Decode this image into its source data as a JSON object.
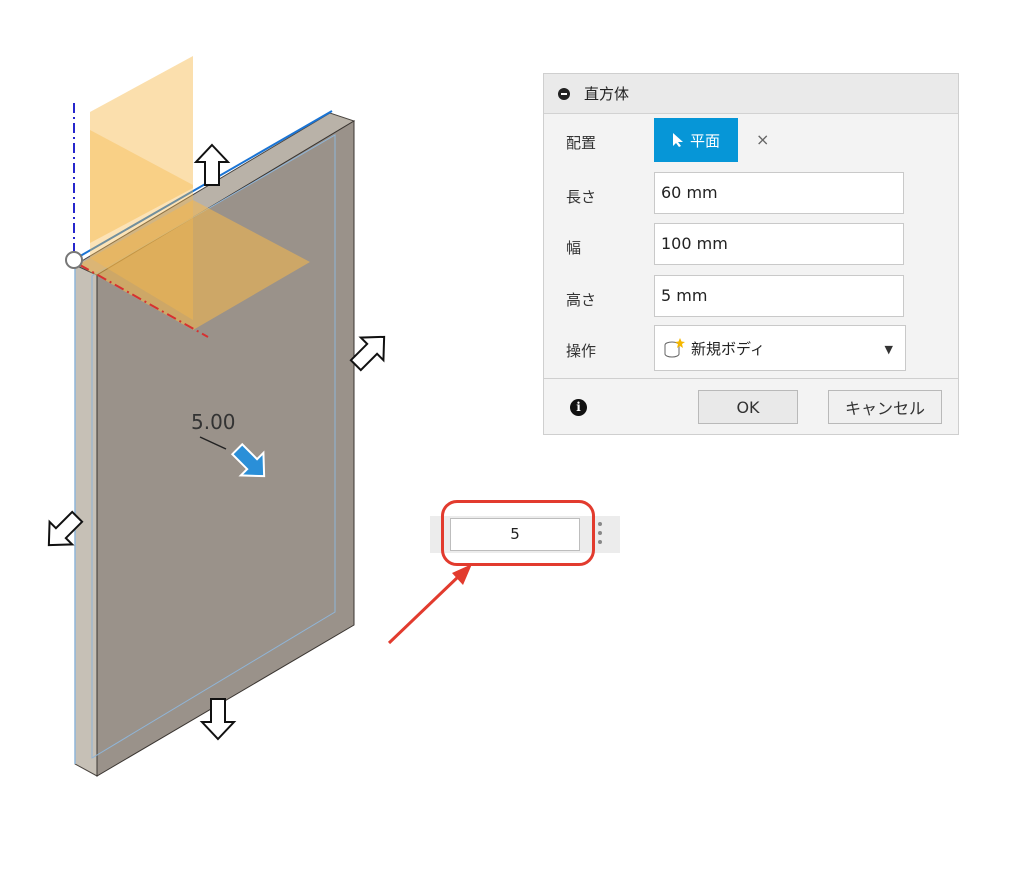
{
  "dialog": {
    "title": "直方体",
    "placement": {
      "label": "配置",
      "button_label": "平面",
      "clear_icon": "×"
    },
    "length": {
      "label": "長さ",
      "value": "60 mm"
    },
    "width": {
      "label": "幅",
      "value": "100 mm"
    },
    "height": {
      "label": "高さ",
      "value": "5 mm"
    },
    "operation": {
      "label": "操作",
      "value": "新規ボディ",
      "icon": "new-body-icon"
    },
    "ok_label": "OK",
    "cancel_label": "キャンセル"
  },
  "viewport": {
    "dimension_label": "5.00",
    "value_input": "5"
  },
  "colors": {
    "accent": "#0696d7",
    "body_face": "#9a928a",
    "plane": "#f7b84a",
    "highlight": "#e23b2e"
  }
}
